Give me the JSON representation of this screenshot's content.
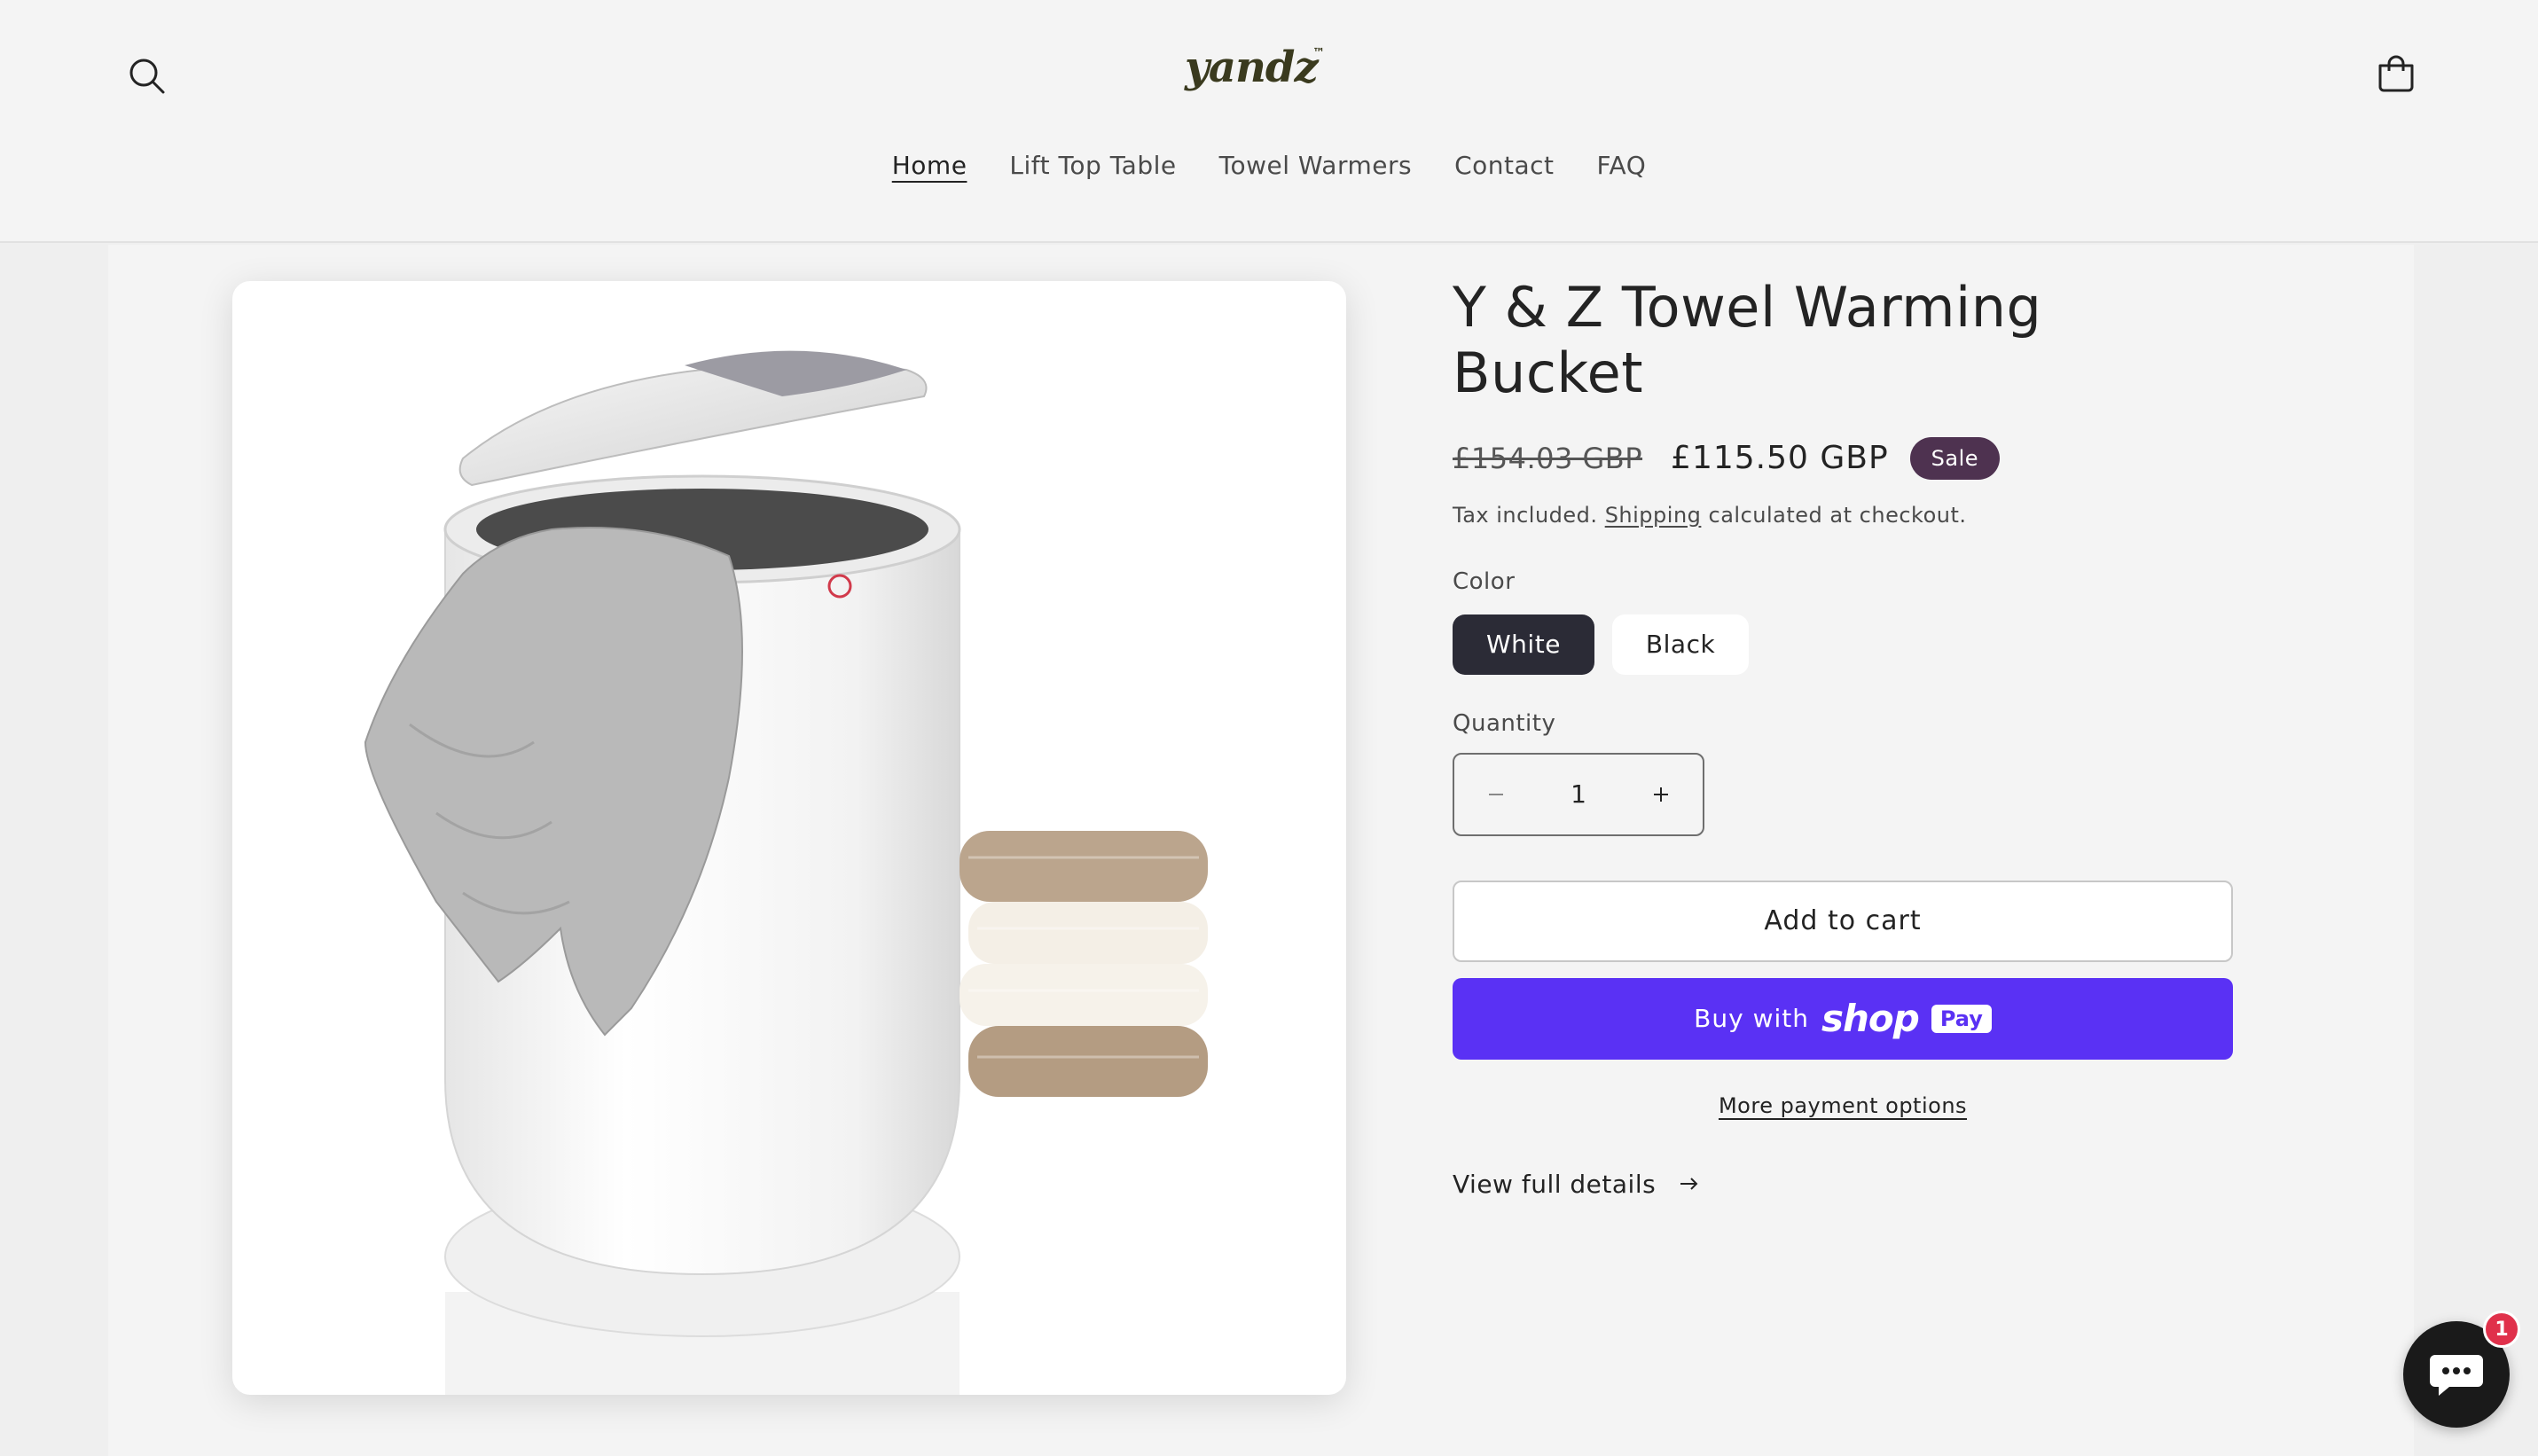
{
  "header": {
    "logo_text": "yandz",
    "logo_tm": "™",
    "search_icon": "search-icon",
    "cart_icon": "cart-icon"
  },
  "nav": {
    "items": [
      {
        "label": "Home",
        "active": true
      },
      {
        "label": "Lift Top Table",
        "active": false
      },
      {
        "label": "Towel Warmers",
        "active": false
      },
      {
        "label": "Contact",
        "active": false
      },
      {
        "label": "FAQ",
        "active": false
      }
    ]
  },
  "product": {
    "title": "Y & Z Towel Warming Bucket",
    "price_old": "£154.03 GBP",
    "price_new": "£115.50 GBP",
    "badge": "Sale",
    "tax_prefix": "Tax included.",
    "tax_link": "Shipping",
    "tax_suffix": "calculated at checkout.",
    "color_label": "Color",
    "colors": [
      {
        "label": "White",
        "selected": true
      },
      {
        "label": "Black",
        "selected": false
      }
    ],
    "quantity_label": "Quantity",
    "quantity_value": "1",
    "add_to_cart": "Add to cart",
    "shoppay_buy": "Buy with",
    "shoppay_shop": "shop",
    "shoppay_pay": "Pay",
    "more_payment": "More payment options",
    "view_full": "View full details"
  },
  "chat": {
    "badge_count": "1"
  },
  "colors": {
    "accent_purple": "#5a31f4",
    "sale_badge": "#4e3250",
    "selected_swatch": "#2b2b36",
    "chat_badge": "#e0314b"
  }
}
